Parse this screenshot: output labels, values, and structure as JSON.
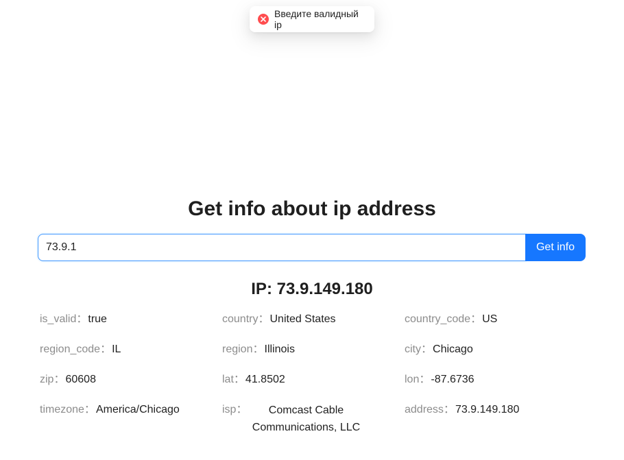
{
  "toast": {
    "message": "Введите валидный ip",
    "type": "error"
  },
  "page": {
    "title": "Get info about ip address"
  },
  "search": {
    "value": "73.9.1",
    "button_label": "Get info"
  },
  "result": {
    "heading": "IP: 73.9.149.180",
    "rows": [
      [
        {
          "label": "is_valid",
          "value": "true"
        },
        {
          "label": "country",
          "value": "United States"
        },
        {
          "label": "country_code",
          "value": "US"
        }
      ],
      [
        {
          "label": "region_code",
          "value": "IL"
        },
        {
          "label": "region",
          "value": "Illinois"
        },
        {
          "label": "city",
          "value": "Chicago"
        }
      ],
      [
        {
          "label": "zip",
          "value": "60608"
        },
        {
          "label": "lat",
          "value": "41.8502"
        },
        {
          "label": "lon",
          "value": "-87.6736"
        }
      ],
      [
        {
          "label": "timezone",
          "value": "America/Chicago"
        },
        {
          "label": "isp",
          "value": "Comcast Cable Communications, LLC"
        },
        {
          "label": "address",
          "value": "73.9.149.180"
        }
      ]
    ]
  },
  "colors": {
    "primary": "#1677ff",
    "error": "#ff4d4f",
    "label": "#8c8c8c"
  }
}
